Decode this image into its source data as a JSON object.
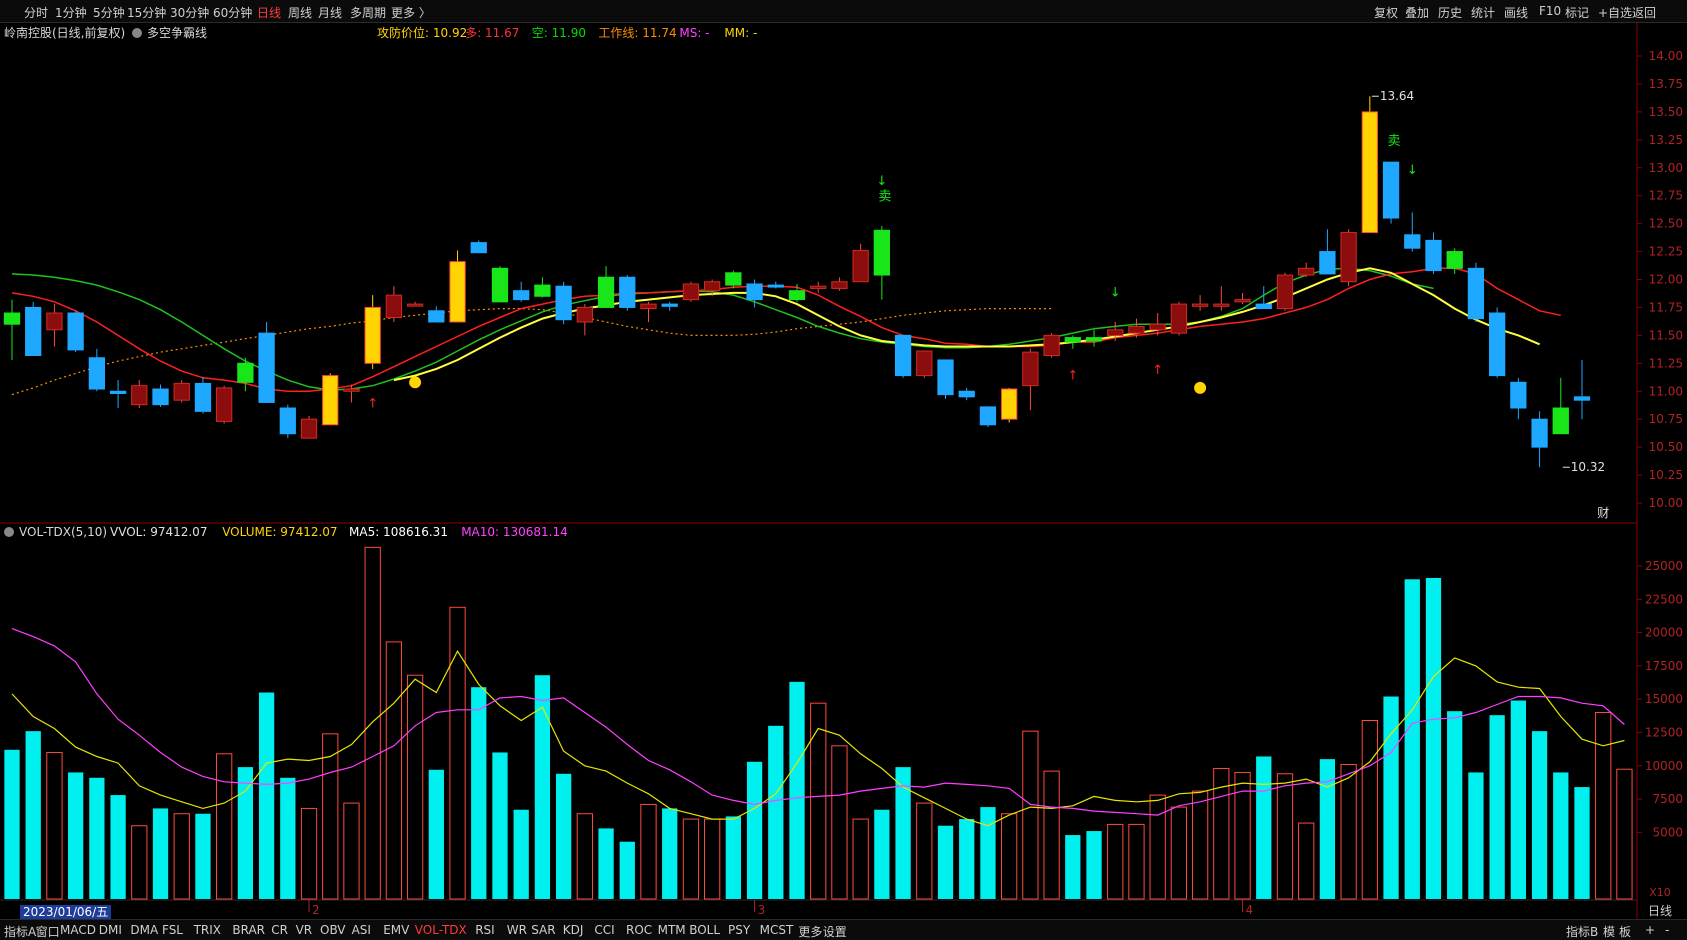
{
  "toolbar": {
    "left": [
      "分时",
      "1分钟",
      "5分钟",
      "15分钟",
      "30分钟",
      "60分钟",
      "日线",
      "周线",
      "月线",
      "多周期",
      "更多 〉"
    ],
    "active": "日线",
    "right": [
      "复权",
      "叠加",
      "历史",
      "统计",
      "画线",
      "F10",
      "标记",
      "+自选",
      "返回"
    ]
  },
  "main_header": {
    "title": "岭南控股(日线,前复权)",
    "indicator": "多空争霸线",
    "items": [
      {
        "text": "攻防价位: 10.92",
        "color": "#ffd400"
      },
      {
        "text": "多: 11.67",
        "color": "#ff3333"
      },
      {
        "text": "空: 11.90",
        "color": "#00dd00"
      },
      {
        "text": "工作线: 11.74",
        "color": "#ff8c00"
      },
      {
        "text": "MS: -",
        "color": "#ff44ff"
      },
      {
        "text": "MM: -",
        "color": "#ffd400"
      }
    ]
  },
  "vol_header": {
    "name": "VOL-TDX(5,10)",
    "items": [
      {
        "text": "VVOL: 97412.07",
        "color": "#e0e0e0"
      },
      {
        "text": "VOLUME: 97412.07",
        "color": "#ffd400"
      },
      {
        "text": "MA5: 108616.31",
        "color": "#ffffff"
      },
      {
        "text": "MA10: 130681.14",
        "color": "#ff44ff"
      }
    ]
  },
  "price_axis": [
    "14.00",
    "13.75",
    "13.50",
    "13.25",
    "13.00",
    "12.75",
    "12.50",
    "12.25",
    "12.00",
    "11.75",
    "11.50",
    "11.25",
    "11.00",
    "10.75",
    "10.50",
    "10.25",
    "10.00"
  ],
  "vol_axis": [
    "25000",
    "22500",
    "20000",
    "17500",
    "15000",
    "12500",
    "10000",
    "7500",
    "5000"
  ],
  "vol_unit": "X10",
  "annotations": {
    "high": "13.64",
    "low": "10.32",
    "sell": "卖",
    "fin": "财",
    "period_label": "日线"
  },
  "date_label": "2023/01/06/五",
  "month_labels": [
    "2",
    "3",
    "4"
  ],
  "bottom_tabs": [
    "指标A",
    "窗口",
    "MACD",
    "DMI",
    "DMA",
    "FSL",
    "TRIX",
    "BRAR",
    "CR",
    "VR",
    "OBV",
    "ASI",
    "EMV",
    "VOL-TDX",
    "RSI",
    "WR",
    "SAR",
    "KDJ",
    "CCI",
    "ROC",
    "MTM",
    "BOLL",
    "PSY",
    "MCST",
    "更多",
    "设置"
  ],
  "bottom_active": "VOL-TDX",
  "bottom_right": [
    "指标B",
    "模",
    "板",
    "+",
    "-"
  ],
  "colors": {
    "up": "#ff4a3c",
    "up_body": "#8b0d0d",
    "down": "#1ea8ff",
    "cyan": "#00f0f0",
    "ma_red": "#ff2020",
    "ma_green": "#20c020",
    "ma_yellow": "#ffff40",
    "ma_orange": "#ff8c00",
    "grid": "#8b0000",
    "vol_ma5": "#e6e600",
    "vol_ma10": "#ff40ff"
  },
  "chart_data": {
    "type": "candlestick",
    "price_range": [
      10.0,
      14.0
    ],
    "volume_range": [
      0,
      26500
    ],
    "candles": [
      {
        "o": 11.7,
        "h": 11.82,
        "l": 11.28,
        "c": 11.6,
        "k": "green"
      },
      {
        "o": 11.75,
        "h": 11.8,
        "l": 11.32,
        "c": 11.32,
        "k": "blue"
      },
      {
        "o": 11.55,
        "h": 11.78,
        "l": 11.4,
        "c": 11.7,
        "k": "red"
      },
      {
        "o": 11.7,
        "h": 11.72,
        "l": 11.35,
        "c": 11.37,
        "k": "blue"
      },
      {
        "o": 11.3,
        "h": 11.38,
        "l": 11.0,
        "c": 11.02,
        "k": "blue"
      },
      {
        "o": 11.0,
        "h": 11.1,
        "l": 10.85,
        "c": 10.98,
        "k": "blue"
      },
      {
        "o": 10.88,
        "h": 11.1,
        "l": 10.85,
        "c": 11.05,
        "k": "red"
      },
      {
        "o": 11.02,
        "h": 11.06,
        "l": 10.86,
        "c": 10.88,
        "k": "blue"
      },
      {
        "o": 10.92,
        "h": 11.1,
        "l": 10.9,
        "c": 11.07,
        "k": "red"
      },
      {
        "o": 11.07,
        "h": 11.13,
        "l": 10.8,
        "c": 10.82,
        "k": "blue"
      },
      {
        "o": 10.73,
        "h": 11.05,
        "l": 10.71,
        "c": 11.03,
        "k": "red"
      },
      {
        "o": 11.08,
        "h": 11.3,
        "l": 11.0,
        "c": 11.25,
        "k": "green"
      },
      {
        "o": 11.52,
        "h": 11.62,
        "l": 10.9,
        "c": 10.9,
        "k": "blue"
      },
      {
        "o": 10.85,
        "h": 10.88,
        "l": 10.58,
        "c": 10.62,
        "k": "blue"
      },
      {
        "o": 10.58,
        "h": 10.78,
        "l": 10.58,
        "c": 10.75,
        "k": "red"
      },
      {
        "o": 10.7,
        "h": 11.16,
        "l": 10.7,
        "c": 11.14,
        "k": "yellow"
      },
      {
        "o": 11.0,
        "h": 11.06,
        "l": 10.9,
        "c": 11.02,
        "k": "red"
      },
      {
        "o": 11.25,
        "h": 11.86,
        "l": 11.2,
        "c": 11.75,
        "k": "yellow"
      },
      {
        "o": 11.66,
        "h": 11.94,
        "l": 11.62,
        "c": 11.86,
        "k": "red"
      },
      {
        "o": 11.78,
        "h": 11.8,
        "l": 11.76,
        "c": 11.78,
        "k": "red"
      },
      {
        "o": 11.72,
        "h": 11.76,
        "l": 11.62,
        "c": 11.62,
        "k": "blue"
      },
      {
        "o": 11.62,
        "h": 12.26,
        "l": 11.62,
        "c": 12.16,
        "k": "yellow"
      },
      {
        "o": 12.33,
        "h": 12.35,
        "l": 12.24,
        "c": 12.24,
        "k": "blue"
      },
      {
        "o": 11.8,
        "h": 12.12,
        "l": 11.8,
        "c": 12.1,
        "k": "green"
      },
      {
        "o": 11.9,
        "h": 11.98,
        "l": 11.8,
        "c": 11.82,
        "k": "blue"
      },
      {
        "o": 11.85,
        "h": 12.02,
        "l": 11.84,
        "c": 11.95,
        "k": "green"
      },
      {
        "o": 11.94,
        "h": 11.98,
        "l": 11.6,
        "c": 11.64,
        "k": "blue"
      },
      {
        "o": 11.62,
        "h": 11.78,
        "l": 11.5,
        "c": 11.75,
        "k": "red"
      },
      {
        "o": 11.75,
        "h": 12.12,
        "l": 11.75,
        "c": 12.02,
        "k": "green"
      },
      {
        "o": 12.02,
        "h": 12.04,
        "l": 11.72,
        "c": 11.75,
        "k": "blue"
      },
      {
        "o": 11.78,
        "h": 11.8,
        "l": 11.62,
        "c": 11.74,
        "k": "red"
      },
      {
        "o": 11.76,
        "h": 11.8,
        "l": 11.72,
        "c": 11.78,
        "k": "blue"
      },
      {
        "o": 11.82,
        "h": 11.98,
        "l": 11.8,
        "c": 11.96,
        "k": "red"
      },
      {
        "o": 11.9,
        "h": 12.0,
        "l": 11.85,
        "c": 11.98,
        "k": "red"
      },
      {
        "o": 11.95,
        "h": 12.08,
        "l": 11.92,
        "c": 12.06,
        "k": "green"
      },
      {
        "o": 11.96,
        "h": 12.0,
        "l": 11.75,
        "c": 11.82,
        "k": "blue"
      },
      {
        "o": 11.94,
        "h": 11.98,
        "l": 11.92,
        "c": 11.95,
        "k": "blue"
      },
      {
        "o": 11.82,
        "h": 11.96,
        "l": 11.8,
        "c": 11.9,
        "k": "green"
      },
      {
        "o": 11.94,
        "h": 11.98,
        "l": 11.88,
        "c": 11.92,
        "k": "red"
      },
      {
        "o": 11.92,
        "h": 12.02,
        "l": 11.9,
        "c": 11.98,
        "k": "red"
      },
      {
        "o": 11.98,
        "h": 12.32,
        "l": 11.98,
        "c": 12.26,
        "k": "red"
      },
      {
        "o": 12.04,
        "h": 12.48,
        "l": 11.82,
        "c": 12.44,
        "k": "green"
      },
      {
        "o": 11.5,
        "h": 11.5,
        "l": 11.12,
        "c": 11.14,
        "k": "blue"
      },
      {
        "o": 11.36,
        "h": 11.36,
        "l": 11.12,
        "c": 11.14,
        "k": "red"
      },
      {
        "o": 11.28,
        "h": 11.28,
        "l": 10.93,
        "c": 10.97,
        "k": "blue"
      },
      {
        "o": 11.0,
        "h": 11.03,
        "l": 10.92,
        "c": 10.95,
        "k": "blue"
      },
      {
        "o": 10.86,
        "h": 10.86,
        "l": 10.68,
        "c": 10.7,
        "k": "blue"
      },
      {
        "o": 10.75,
        "h": 11.03,
        "l": 10.72,
        "c": 11.02,
        "k": "yellow"
      },
      {
        "o": 11.05,
        "h": 11.38,
        "l": 10.83,
        "c": 11.35,
        "k": "red"
      },
      {
        "o": 11.32,
        "h": 11.52,
        "l": 11.3,
        "c": 11.5,
        "k": "red"
      },
      {
        "o": 11.48,
        "h": 11.5,
        "l": 11.38,
        "c": 11.44,
        "k": "green"
      },
      {
        "o": 11.45,
        "h": 11.55,
        "l": 11.4,
        "c": 11.48,
        "k": "green"
      },
      {
        "o": 11.5,
        "h": 11.62,
        "l": 11.45,
        "c": 11.55,
        "k": "red"
      },
      {
        "o": 11.52,
        "h": 11.65,
        "l": 11.48,
        "c": 11.58,
        "k": "red"
      },
      {
        "o": 11.55,
        "h": 11.7,
        "l": 11.5,
        "c": 11.6,
        "k": "red"
      },
      {
        "o": 11.52,
        "h": 11.8,
        "l": 11.5,
        "c": 11.78,
        "k": "red"
      },
      {
        "o": 11.76,
        "h": 11.86,
        "l": 11.72,
        "c": 11.78,
        "k": "red"
      },
      {
        "o": 11.76,
        "h": 11.94,
        "l": 11.72,
        "c": 11.78,
        "k": "red"
      },
      {
        "o": 11.8,
        "h": 11.88,
        "l": 11.78,
        "c": 11.82,
        "k": "red"
      },
      {
        "o": 11.78,
        "h": 11.94,
        "l": 11.74,
        "c": 11.74,
        "k": "blue"
      },
      {
        "o": 11.74,
        "h": 12.06,
        "l": 11.72,
        "c": 12.04,
        "k": "red"
      },
      {
        "o": 12.04,
        "h": 12.15,
        "l": 12.02,
        "c": 12.1,
        "k": "red"
      },
      {
        "o": 12.25,
        "h": 12.45,
        "l": 12.05,
        "c": 12.05,
        "k": "blue"
      },
      {
        "o": 11.98,
        "h": 12.45,
        "l": 11.94,
        "c": 12.42,
        "k": "red"
      },
      {
        "o": 12.42,
        "h": 13.64,
        "l": 12.42,
        "c": 13.5,
        "k": "yellow"
      },
      {
        "o": 13.05,
        "h": 13.05,
        "l": 12.5,
        "c": 12.55,
        "k": "blue"
      },
      {
        "o": 12.4,
        "h": 12.6,
        "l": 12.25,
        "c": 12.28,
        "k": "blue"
      },
      {
        "o": 12.35,
        "h": 12.42,
        "l": 12.05,
        "c": 12.08,
        "k": "blue"
      },
      {
        "o": 12.1,
        "h": 12.28,
        "l": 12.05,
        "c": 12.25,
        "k": "green"
      },
      {
        "o": 12.1,
        "h": 12.15,
        "l": 11.62,
        "c": 11.65,
        "k": "blue"
      },
      {
        "o": 11.7,
        "h": 11.75,
        "l": 11.12,
        "c": 11.14,
        "k": "blue"
      },
      {
        "o": 11.08,
        "h": 11.12,
        "l": 10.75,
        "c": 10.85,
        "k": "blue"
      },
      {
        "o": 10.75,
        "h": 10.82,
        "l": 10.32,
        "c": 10.5,
        "k": "blue"
      },
      {
        "o": 10.62,
        "h": 11.12,
        "l": 10.62,
        "c": 10.85,
        "k": "green"
      },
      {
        "o": 10.92,
        "h": 11.28,
        "l": 10.75,
        "c": 10.95,
        "k": "blue"
      }
    ],
    "volumes": [
      11200,
      12600,
      11000,
      9500,
      9100,
      7800,
      5500,
      6800,
      6400,
      6400,
      10900,
      9900,
      15500,
      9100,
      6800,
      12400,
      7200,
      26400,
      19300,
      16800,
      9700,
      21900,
      15900,
      11000,
      6700,
      16800,
      9400,
      6400,
      5300,
      4300,
      7100,
      6800,
      6000,
      6000,
      6200,
      10300,
      13000,
      16300,
      14700,
      11500,
      6000,
      6700,
      9900,
      7200,
      5500,
      6000,
      6900,
      6400,
      12600,
      9600,
      4800,
      5100,
      5600,
      5600,
      7800,
      6900,
      8100,
      9800,
      9500,
      10700,
      9400,
      5700,
      10500,
      10100,
      13400,
      15200,
      24000,
      24100,
      14100,
      9500,
      13800,
      14900,
      12600,
      9500,
      8400,
      14000,
      9741
    ],
    "vol_ma5": [
      15400,
      13700,
      12800,
      11400,
      10700,
      10200,
      8500,
      7800,
      7300,
      6800,
      7200,
      8100,
      10200,
      10500,
      10400,
      10700,
      11600,
      13300,
      14700,
      16500,
      15500,
      18600,
      16100,
      14500,
      13400,
      14400,
      11100,
      10000,
      9600,
      8700,
      7900,
      6800,
      6400,
      6000,
      6000,
      6800,
      7900,
      10200,
      12800,
      12300,
      10900,
      9800,
      8400,
      7600,
      6800,
      6000,
      5500,
      6300,
      6900,
      6800,
      7000,
      7700,
      7400,
      7300,
      7400,
      7900,
      8000,
      8400,
      8700,
      8600,
      8700,
      9000,
      8400,
      9100,
      10300,
      12400,
      14200,
      16700,
      18100,
      17500,
      16300,
      15900,
      15800,
      13700,
      12000,
      11500,
      11900
    ],
    "vol_ma10": [
      20300,
      19700,
      19000,
      17800,
      15400,
      13500,
      12300,
      11000,
      9900,
      9200,
      8800,
      8700,
      8600,
      8700,
      9000,
      9500,
      9900,
      10700,
      11500,
      13000,
      14000,
      14200,
      14200,
      15100,
      15200,
      14900,
      15100,
      14000,
      12900,
      11600,
      10400,
      9700,
      8800,
      7800,
      7400,
      7100,
      7400,
      7600,
      7700,
      7800,
      8100,
      8300,
      8500,
      8400,
      8700,
      8600,
      8500,
      8300,
      7100,
      6900,
      6800,
      6600,
      6500,
      6400,
      6300,
      7000,
      7300,
      7700,
      8100,
      8100,
      8500,
      8700,
      8800,
      9400,
      10000,
      11000,
      13200,
      13500,
      13600,
      14000,
      14600,
      15200,
      15200,
      15100,
      14700,
      14500,
      13100
    ],
    "ma_red": [
      11.88,
      11.85,
      11.8,
      11.72,
      11.62,
      11.5,
      11.38,
      11.27,
      11.18,
      11.12,
      11.1,
      11.07,
      11.02,
      11.0,
      11.0,
      11.02,
      11.05,
      11.13,
      11.22,
      11.31,
      11.4,
      11.49,
      11.58,
      11.66,
      11.74,
      11.78,
      11.82,
      11.85,
      11.86,
      11.88,
      11.88,
      11.89,
      11.9,
      11.91,
      11.93,
      11.94,
      11.94,
      11.93,
      11.86,
      11.76,
      11.67,
      11.57,
      11.5,
      11.47,
      11.43,
      11.42,
      11.4,
      11.4,
      11.4,
      11.41,
      11.44,
      11.44,
      11.48,
      11.5,
      11.52,
      11.55,
      11.58,
      11.6,
      11.62,
      11.65,
      11.7,
      11.75,
      11.82,
      11.92,
      12.0,
      12.05,
      12.07,
      12.1,
      12.1,
      12.05,
      11.92,
      11.82,
      11.72,
      11.68
    ],
    "ma_green": [
      12.05,
      12.04,
      12.02,
      11.99,
      11.95,
      11.89,
      11.82,
      11.73,
      11.62,
      11.5,
      11.38,
      11.27,
      11.18,
      11.1,
      11.04,
      11.01,
      11.02,
      11.05,
      11.11,
      11.18,
      11.26,
      11.36,
      11.46,
      11.55,
      11.63,
      11.71,
      11.77,
      11.81,
      11.85,
      11.87,
      11.88,
      11.89,
      11.9,
      11.89,
      11.86,
      11.8,
      11.73,
      11.66,
      11.58,
      11.52,
      11.47,
      11.44,
      11.42,
      11.4,
      11.39,
      11.39,
      11.4,
      11.42,
      11.45,
      11.48,
      11.52,
      11.56,
      11.58,
      11.6,
      11.6,
      11.6,
      11.62,
      11.67,
      11.74,
      11.86,
      11.97,
      12.04,
      12.09,
      12.1,
      12.08,
      12.03,
      11.96,
      11.92
    ],
    "ma_yellow": [
      11.1,
      11.14,
      11.2,
      11.28,
      11.38,
      11.48,
      11.57,
      11.65,
      11.7,
      11.74,
      11.77,
      11.8,
      11.82,
      11.84,
      11.86,
      11.87,
      11.88,
      11.88,
      11.85,
      11.78,
      11.68,
      11.58,
      11.5,
      11.45,
      11.43,
      11.41,
      11.4,
      11.4,
      11.4,
      11.4,
      11.41,
      11.42,
      11.44,
      11.46,
      11.49,
      11.52,
      11.55,
      11.58,
      11.62,
      11.66,
      11.71,
      11.77,
      11.84,
      11.92,
      12.0,
      12.06,
      12.1,
      12.06,
      11.96,
      11.86,
      11.74,
      11.64,
      11.56,
      11.5,
      11.42
    ],
    "ma_orange_dotted": [
      10.97,
      11.03,
      11.1,
      11.16,
      11.22,
      11.27,
      11.31,
      11.35,
      11.38,
      11.41,
      11.44,
      11.47,
      11.5,
      11.53,
      11.56,
      11.58,
      11.61,
      11.63,
      11.66,
      11.68,
      11.7,
      11.72,
      11.73,
      11.74,
      11.74,
      11.73,
      11.7,
      11.66,
      11.62,
      11.58,
      11.55,
      11.52,
      11.5,
      11.5,
      11.5,
      11.51,
      11.53,
      11.56,
      11.58,
      11.6,
      11.62,
      11.65,
      11.68,
      11.7,
      11.72,
      11.73,
      11.74,
      11.74,
      11.74,
      11.74
    ]
  }
}
